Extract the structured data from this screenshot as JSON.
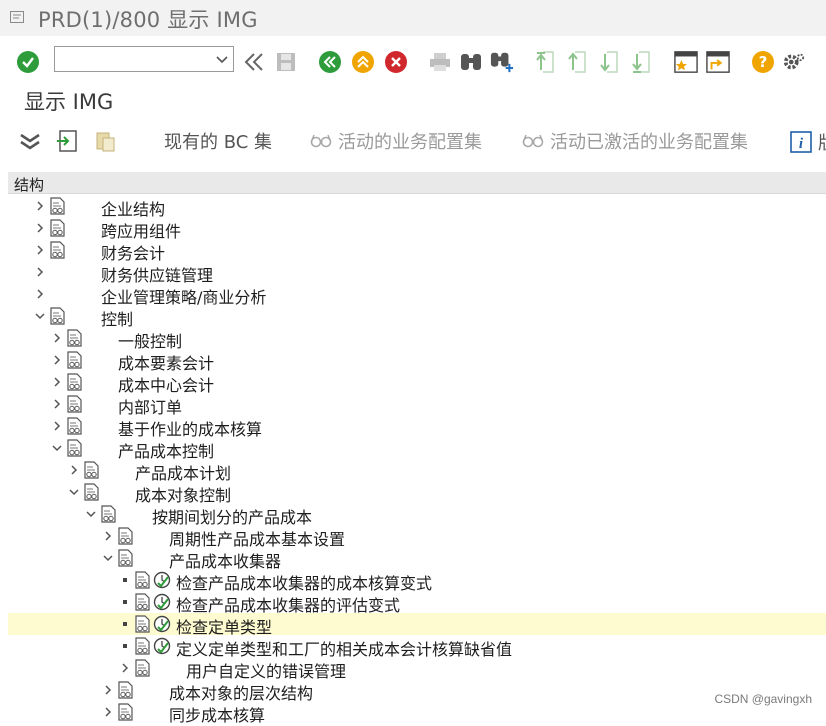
{
  "window": {
    "title": "PRD(1)/800 显示 IMG",
    "icon": "window-menu-icon"
  },
  "toolbar": {
    "command_field": {
      "value": "",
      "placeholder": ""
    },
    "icons": [
      "enter-check-icon",
      "command-dropdown-icon",
      "collapse-toolbar-icon",
      "save-icon",
      "back-icon",
      "exit-icon",
      "cancel-icon",
      "print-icon",
      "find-icon",
      "find-next-icon",
      "first-page-icon",
      "previous-page-icon",
      "next-page-icon",
      "last-page-icon",
      "create-session-icon",
      "shortcut-icon",
      "help-icon",
      "settings-icon"
    ]
  },
  "screen": {
    "title": "显示 IMG"
  },
  "app_toolbar": {
    "existing_bc_sets": "现有的 BC 集",
    "active_business_config_sets": "活动的业务配置集",
    "activated_business_config_sets": "活动已激活的业务配置集",
    "info_truncated": "版"
  },
  "tree": {
    "header": "结构",
    "nodes": [
      {
        "label": "企业结构",
        "level": 0,
        "state": "collapsed",
        "doc": true,
        "exec": false,
        "selected": false
      },
      {
        "label": "跨应用组件",
        "level": 0,
        "state": "collapsed",
        "doc": true,
        "exec": false,
        "selected": false
      },
      {
        "label": "财务会计",
        "level": 0,
        "state": "collapsed",
        "doc": true,
        "exec": false,
        "selected": false
      },
      {
        "label": "财务供应链管理",
        "level": 0,
        "state": "collapsed",
        "doc": false,
        "exec": false,
        "selected": false
      },
      {
        "label": "企业管理策略/商业分析",
        "level": 0,
        "state": "collapsed",
        "doc": false,
        "exec": false,
        "selected": false
      },
      {
        "label": "控制",
        "level": 0,
        "state": "expanded",
        "doc": true,
        "exec": false,
        "selected": false
      },
      {
        "label": "一般控制",
        "level": 1,
        "state": "collapsed",
        "doc": true,
        "exec": false,
        "selected": false
      },
      {
        "label": "成本要素会计",
        "level": 1,
        "state": "collapsed",
        "doc": true,
        "exec": false,
        "selected": false
      },
      {
        "label": "成本中心会计",
        "level": 1,
        "state": "collapsed",
        "doc": true,
        "exec": false,
        "selected": false
      },
      {
        "label": "内部订单",
        "level": 1,
        "state": "collapsed",
        "doc": true,
        "exec": false,
        "selected": false
      },
      {
        "label": "基于作业的成本核算",
        "level": 1,
        "state": "collapsed",
        "doc": true,
        "exec": false,
        "selected": false
      },
      {
        "label": "产品成本控制",
        "level": 1,
        "state": "expanded",
        "doc": true,
        "exec": false,
        "selected": false
      },
      {
        "label": "产品成本计划",
        "level": 2,
        "state": "collapsed",
        "doc": true,
        "exec": false,
        "selected": false
      },
      {
        "label": "成本对象控制",
        "level": 2,
        "state": "expanded",
        "doc": true,
        "exec": false,
        "selected": false
      },
      {
        "label": "按期间划分的产品成本",
        "level": 3,
        "state": "expanded",
        "doc": true,
        "exec": false,
        "selected": false
      },
      {
        "label": "周期性产品成本基本设置",
        "level": 4,
        "state": "collapsed",
        "doc": true,
        "exec": false,
        "selected": false
      },
      {
        "label": "产品成本收集器",
        "level": 4,
        "state": "expanded",
        "doc": true,
        "exec": false,
        "selected": false
      },
      {
        "label": "检查产品成本收集器的成本核算变式",
        "level": 5,
        "state": "leaf",
        "doc": true,
        "exec": true,
        "selected": false
      },
      {
        "label": "检查产品成本收集器的评估变式",
        "level": 5,
        "state": "leaf",
        "doc": true,
        "exec": true,
        "selected": false
      },
      {
        "label": "检查定单类型",
        "level": 5,
        "state": "leaf",
        "doc": true,
        "exec": true,
        "selected": true
      },
      {
        "label": "定义定单类型和工厂的相关成本会计核算缺省值",
        "level": 5,
        "state": "leaf",
        "doc": true,
        "exec": true,
        "selected": false
      },
      {
        "label": "用户自定义的错误管理",
        "level": 5,
        "state": "collapsed",
        "doc": true,
        "exec": false,
        "selected": false
      },
      {
        "label": "成本对象的层次结构",
        "level": 4,
        "state": "collapsed",
        "doc": true,
        "exec": false,
        "selected": false
      },
      {
        "label": "同步成本核算",
        "level": 4,
        "state": "collapsed",
        "doc": true,
        "exec": false,
        "selected": false
      }
    ]
  },
  "watermark": "CSDN @gavingxh"
}
